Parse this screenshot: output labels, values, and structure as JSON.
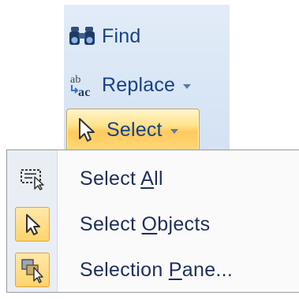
{
  "ribbon": {
    "find": {
      "label": "Find",
      "icon": "binoculars-icon"
    },
    "replace": {
      "label": "Replace",
      "icon": "replace-ab-icon",
      "icon_text_top": "ab",
      "icon_text_bottom": "ac"
    },
    "select": {
      "label": "Select",
      "icon": "cursor-arrow-icon",
      "state": "pressed"
    }
  },
  "menu": {
    "items": [
      {
        "pre": "Select ",
        "mnemonic": "A",
        "post": "ll",
        "icon": "select-all-icon",
        "checked": false
      },
      {
        "pre": "Select ",
        "mnemonic": "O",
        "post": "bjects",
        "icon": "cursor-arrow-icon",
        "checked": true
      },
      {
        "pre": "Selection ",
        "mnemonic": "P",
        "post": "ane...",
        "icon": "selection-pane-icon",
        "checked": true
      }
    ]
  },
  "colors": {
    "ribbon_text": "#15428b",
    "menu_text": "#1f2f5c",
    "highlight": "#ffd36e"
  }
}
